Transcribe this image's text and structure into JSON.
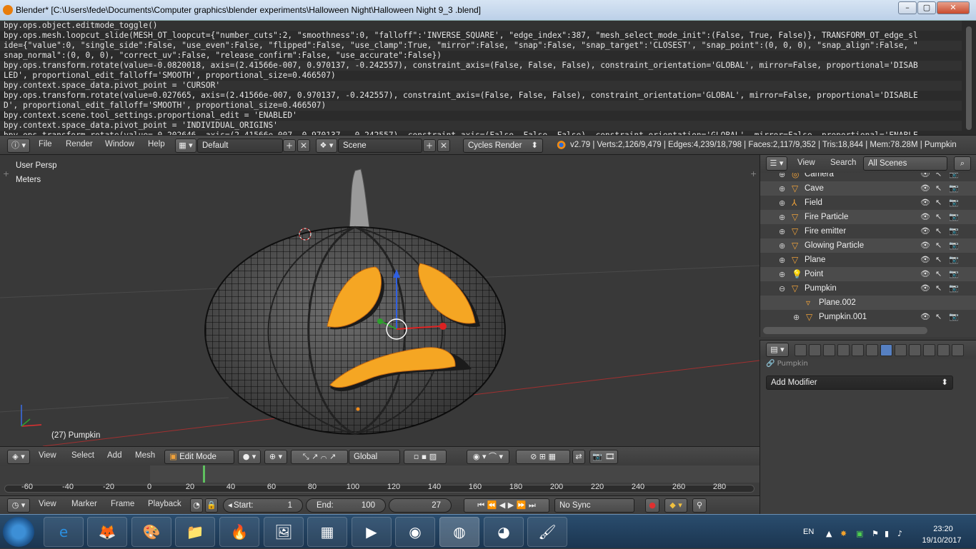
{
  "window": {
    "title": "Blender* [C:\\Users\\fede\\Documents\\Computer graphics\\blender experiments\\Halloween Night\\Halloween Night 9_3 .blend]",
    "minimize": "–",
    "maximize": "▢",
    "close": "✕"
  },
  "console": {
    "lines": [
      "bpy.ops.object.editmode_toggle()",
      "bpy.ops.mesh.loopcut_slide(MESH_OT_loopcut={\"number_cuts\":2, \"smoothness\":0, \"falloff\":'INVERSE_SQUARE', \"edge_index\":387, \"mesh_select_mode_init\":(False, True, False)}, TRANSFORM_OT_edge_sl",
      "ide={\"value\":0, \"single_side\":False, \"use_even\":False, \"flipped\":False, \"use_clamp\":True, \"mirror\":False, \"snap\":False, \"snap_target\":'CLOSEST', \"snap_point\":(0, 0, 0), \"snap_align\":False, \"",
      "snap_normal\":(0, 0, 0), \"correct_uv\":False, \"release_confirm\":False, \"use_accurate\":False})",
      "bpy.ops.transform.rotate(value=-0.0820018, axis=(2.41566e-007, 0.970137, -0.242557), constraint_axis=(False, False, False), constraint_orientation='GLOBAL', mirror=False, proportional='DISAB",
      "LED', proportional_edit_falloff='SMOOTH', proportional_size=0.466507)",
      "bpy.context.space_data.pivot_point = 'CURSOR'",
      "bpy.ops.transform.rotate(value=0.027665, axis=(2.41566e-007, 0.970137, -0.242557), constraint_axis=(False, False, False), constraint_orientation='GLOBAL', mirror=False, proportional='DISABLE",
      "D', proportional_edit_falloff='SMOOTH', proportional_size=0.466507)",
      "bpy.context.scene.tool_settings.proportional_edit = 'ENABLED'",
      "bpy.context.space_data.pivot_point = 'INDIVIDUAL_ORIGINS'",
      "bpy.ops.transform.rotate(value=-0.202646, axis=(2.41566e-007, 0.970137, -0.242557), constraint_axis=(False, False, False), constraint_orientation='GLOBAL', mirror=False, proportional='ENABLE"
    ]
  },
  "topbar": {
    "menus": [
      "File",
      "Render",
      "Window",
      "Help"
    ],
    "layout": "Default",
    "scene": "Scene",
    "engine": "Cycles Render",
    "stats": "v2.79 | Verts:2,126/9,479 | Edges:4,239/18,798 | Faces:2,117/9,352 | Tris:18,844 | Mem:78.28M | Pumpkin"
  },
  "viewport": {
    "view_label": "User Persp",
    "units_label": "Meters",
    "object_label": "(27) Pumpkin",
    "colors": {
      "background": "#393939",
      "pumpkin_wire": "#141414",
      "mouth_eyes": "#f5a623",
      "grid_red": "#a23030"
    }
  },
  "viewport_header": {
    "menus": [
      "View",
      "Select",
      "Add",
      "Mesh"
    ],
    "mode": "Edit Mode",
    "orientation": "Global"
  },
  "timeline": {
    "ticks": [
      "-60",
      "-40",
      "-20",
      "0",
      "20",
      "40",
      "60",
      "80",
      "100",
      "120",
      "140",
      "160",
      "180",
      "200",
      "220",
      "240",
      "260",
      "280"
    ],
    "current_frame_value": 27
  },
  "timeline_header": {
    "menus": [
      "View",
      "Marker",
      "Frame",
      "Playback"
    ],
    "start_label": "Start:",
    "start_value": "1",
    "end_label": "End:",
    "end_value": "100",
    "current_frame": "27",
    "sync": "No Sync"
  },
  "outliner": {
    "header_menus": [
      "View",
      "Search"
    ],
    "filter": "All Scenes",
    "rows": [
      {
        "name": "Camera",
        "icon": "camera-icon"
      },
      {
        "name": "Cave",
        "icon": "mesh-icon"
      },
      {
        "name": "Field",
        "icon": "field-icon"
      },
      {
        "name": "Fire Particle",
        "icon": "mesh-icon"
      },
      {
        "name": "Fire emitter",
        "icon": "mesh-icon"
      },
      {
        "name": "Glowing Particle",
        "icon": "mesh-icon"
      },
      {
        "name": "Plane",
        "icon": "mesh-icon"
      },
      {
        "name": "Point",
        "icon": "lamp-icon"
      },
      {
        "name": "Pumpkin",
        "icon": "mesh-icon"
      },
      {
        "name": "Plane.002",
        "icon": "mesh-data-icon"
      },
      {
        "name": "Pumpkin.001",
        "icon": "mesh-icon"
      }
    ]
  },
  "properties": {
    "context_label": "Pumpkin",
    "add_modifier": "Add Modifier"
  },
  "taskbar": {
    "lang": "EN",
    "time": "23:20",
    "date": "19/10/2017"
  }
}
